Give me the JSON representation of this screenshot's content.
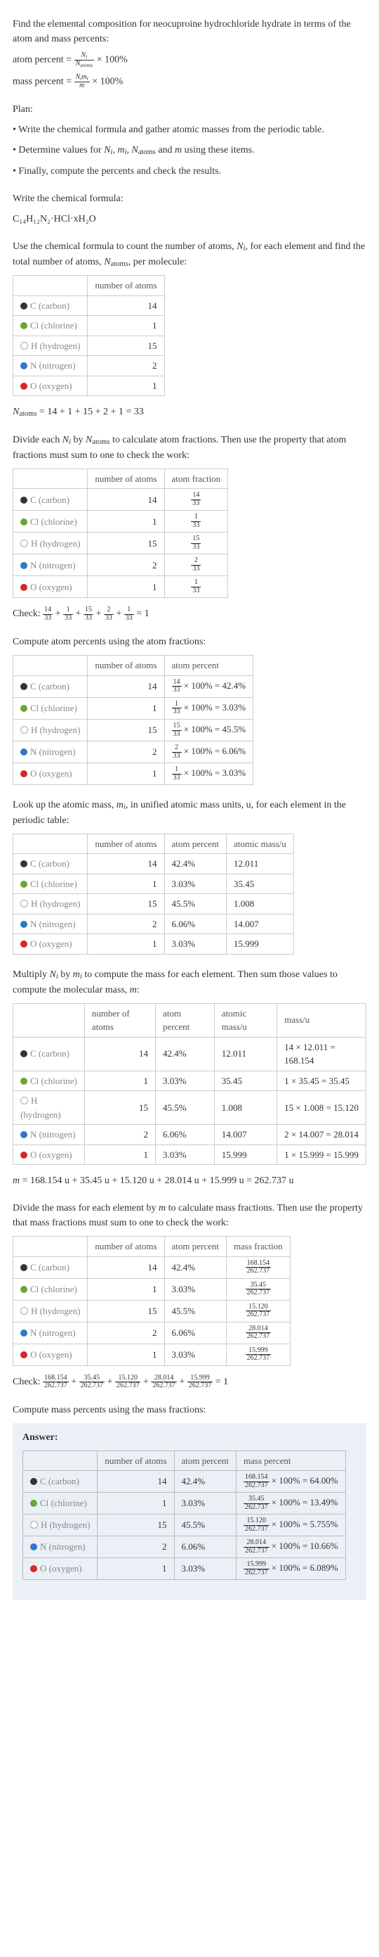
{
  "intro_line": "Find the elemental composition for neocuproine hydrochloride hydrate in terms of the atom and mass percents:",
  "atom_percent_label": "atom percent = ",
  "atom_percent_after": " × 100%",
  "mass_percent_label": "mass percent = ",
  "mass_percent_after": " × 100%",
  "plan_heading": "Plan:",
  "plan_lines": {
    "l1": "• Write the chemical formula and gather atomic masses from the periodic table.",
    "l2_pre": "• Determine values for ",
    "l2_post": " using these items.",
    "l3": "• Finally, compute the percents and check the results."
  },
  "formula_heading": "Write the chemical formula:",
  "formula_text": "C₁₄H₁₂N₂·HCl·xH₂O",
  "count_heading_pre": "Use the chemical formula to count the number of atoms, ",
  "count_heading_mid": ", for each element and find the total number of atoms, ",
  "count_heading_post": ", per molecule:",
  "headers": {
    "elem": "",
    "num_atoms": "number of atoms",
    "atom_fraction": "atom fraction",
    "atom_percent": "atom percent",
    "atomic_mass": "atomic mass/u",
    "mass_u": "mass/u",
    "mass_fraction": "mass fraction",
    "mass_percent": "mass percent"
  },
  "elements": {
    "C": {
      "name": "C (carbon)",
      "n": "14"
    },
    "Cl": {
      "name": "Cl (chlorine)",
      "n": "1"
    },
    "H": {
      "name": "H (hydrogen)",
      "n": "15"
    },
    "N": {
      "name": "N (nitrogen)",
      "n": "2"
    },
    "O": {
      "name": "O (oxygen)",
      "n": "1"
    }
  },
  "natoms_line": "N_atoms = 14 + 1 + 15 + 2 + 1 = 33",
  "divide_heading_pre": "Divide each ",
  "divide_heading_mid": " by ",
  "divide_heading_post": " to calculate atom fractions. Then use the property that atom fractions must sum to one to check the work:",
  "fractions": {
    "C": {
      "top": "14",
      "bot": "33"
    },
    "Cl": {
      "top": "1",
      "bot": "33"
    },
    "H": {
      "top": "15",
      "bot": "33"
    },
    "N": {
      "top": "2",
      "bot": "33"
    },
    "O": {
      "top": "1",
      "bot": "33"
    }
  },
  "check_label": "Check: ",
  "check_sum_right": " = 1",
  "compute_atom_percent_heading": "Compute atom percents using the atom fractions:",
  "percent_suffix": " × 100% = ",
  "atom_percents": {
    "C": "42.4%",
    "Cl": "3.03%",
    "H": "45.5%",
    "N": "6.06%",
    "O": "3.03%"
  },
  "lookup_heading_pre": "Look up the atomic mass, ",
  "lookup_heading_post": ", in unified atomic mass units, u, for each element in the periodic table:",
  "atomic_masses": {
    "C": "12.011",
    "Cl": "35.45",
    "H": "1.008",
    "N": "14.007",
    "O": "15.999"
  },
  "multiply_heading_pre": "Multiply ",
  "multiply_heading_mid": " by ",
  "multiply_heading_mid2": " to compute the mass for each element. Then sum those values to compute the molecular mass, ",
  "multiply_heading_post": ":",
  "mass_calc": {
    "C": "14 × 12.011 = 168.154",
    "Cl": "1 × 35.45 = 35.45",
    "H": "15 × 1.008 = 15.120",
    "N": "2 × 14.007 = 28.014",
    "O": "1 × 15.999 = 15.999"
  },
  "m_line": "m = 168.154 u + 35.45 u + 15.120 u + 28.014 u + 15.999 u = 262.737 u",
  "mass_fraction_heading_pre": "Divide the mass for each element by ",
  "mass_fraction_heading_post": " to calculate mass fractions. Then use the property that mass fractions must sum to one to check the work:",
  "mass_fractions": {
    "C": {
      "top": "168.154",
      "bot": "262.737"
    },
    "Cl": {
      "top": "35.45",
      "bot": "262.737"
    },
    "H": {
      "top": "15.120",
      "bot": "262.737"
    },
    "N": {
      "top": "28.014",
      "bot": "262.737"
    },
    "O": {
      "top": "15.999",
      "bot": "262.737"
    }
  },
  "compute_mass_percent_heading": "Compute mass percents using the mass fractions:",
  "answer_label": "Answer:",
  "mass_percents": {
    "C": "64.00%",
    "Cl": "13.49%",
    "H": "5.755%",
    "N": "10.66%",
    "O": "6.089%"
  }
}
